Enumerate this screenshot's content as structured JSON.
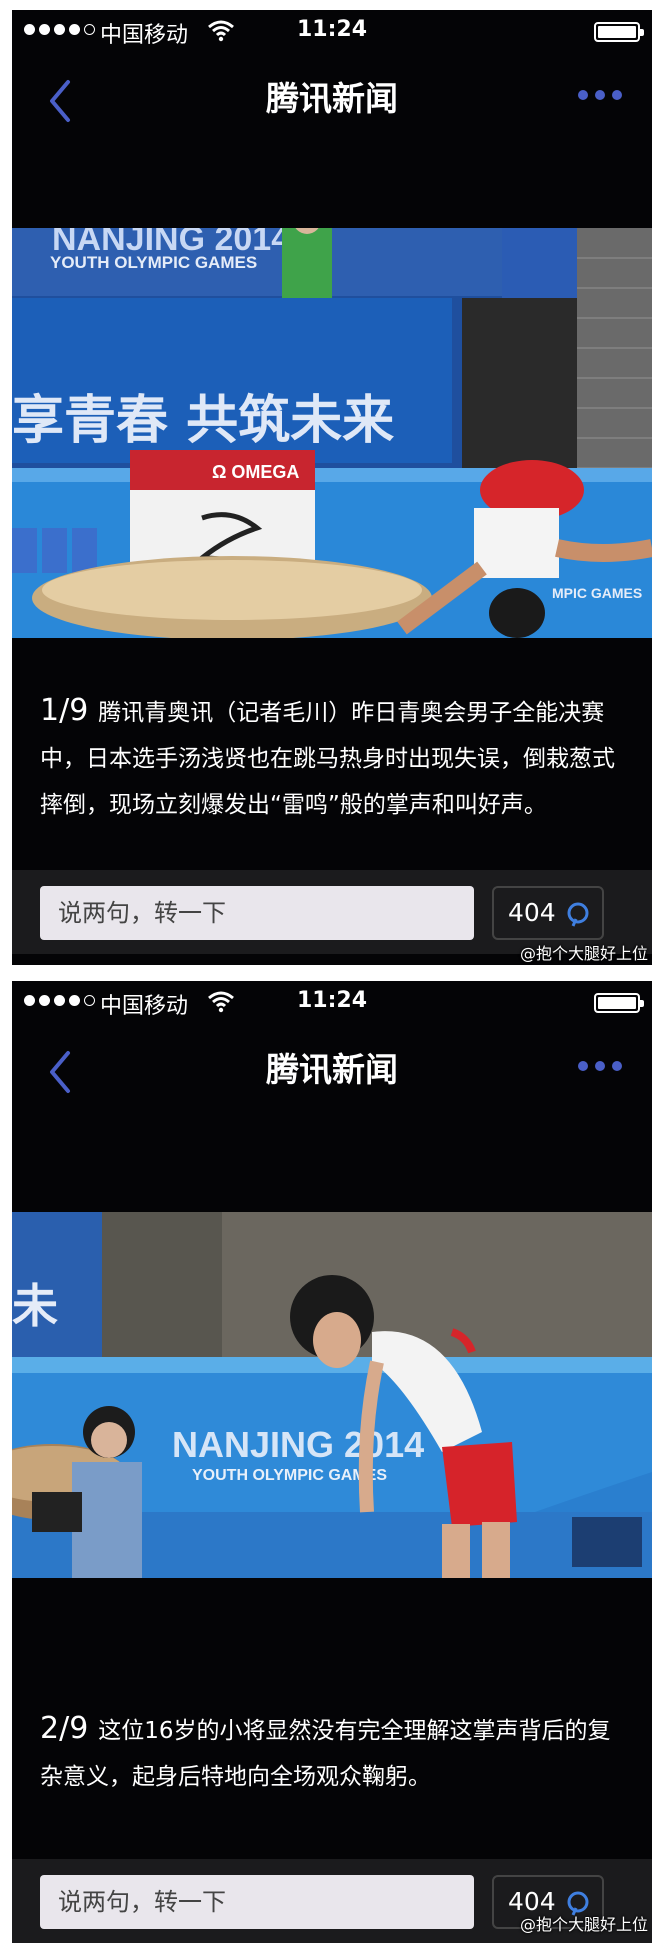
{
  "status_bar": {
    "carrier": "中国移动",
    "time": "11:24"
  },
  "nav": {
    "title": "腾讯新闻",
    "back_icon": "chevron-left-icon",
    "more_icon": "more-dots-icon"
  },
  "photo1": {
    "banner_text": "NANJING 2014",
    "banner_subtext": "YOUTH OLYMPIC GAMES",
    "slogan_text": "享青春 共筑未来",
    "sponsor_text": "Ω OMEGA",
    "side_text": "MPIC GAMES"
  },
  "photo2": {
    "banner_text": "NANJING 2014",
    "banner_subtext": "YOUTH OLYMPIC GAMES",
    "left_text": "未"
  },
  "slides": [
    {
      "index": "1/9",
      "caption": "腾讯青奥讯（记者毛川）昨日青奥会男子全能决赛中，日本选手汤浅贤也在跳马热身时出现失误，倒栽葱式摔倒，现场立刻爆发出“雷鸣”般的掌声和叫好声。",
      "comment_placeholder": "说两句，转一下",
      "comment_count": "404"
    },
    {
      "index": "2/9",
      "caption": "这位16岁的小将显然没有完全理解这掌声背后的复杂意义，起身后特地向全场观众鞠躬。",
      "comment_placeholder": "说两句，转一下",
      "comment_count": "404"
    }
  ],
  "watermark": "@抱个大腿好上位",
  "colors": {
    "background": "#040406",
    "accent": "#4a5fc8",
    "bottom_bar": "#1b1b1d",
    "input": "#e9e6ec"
  }
}
